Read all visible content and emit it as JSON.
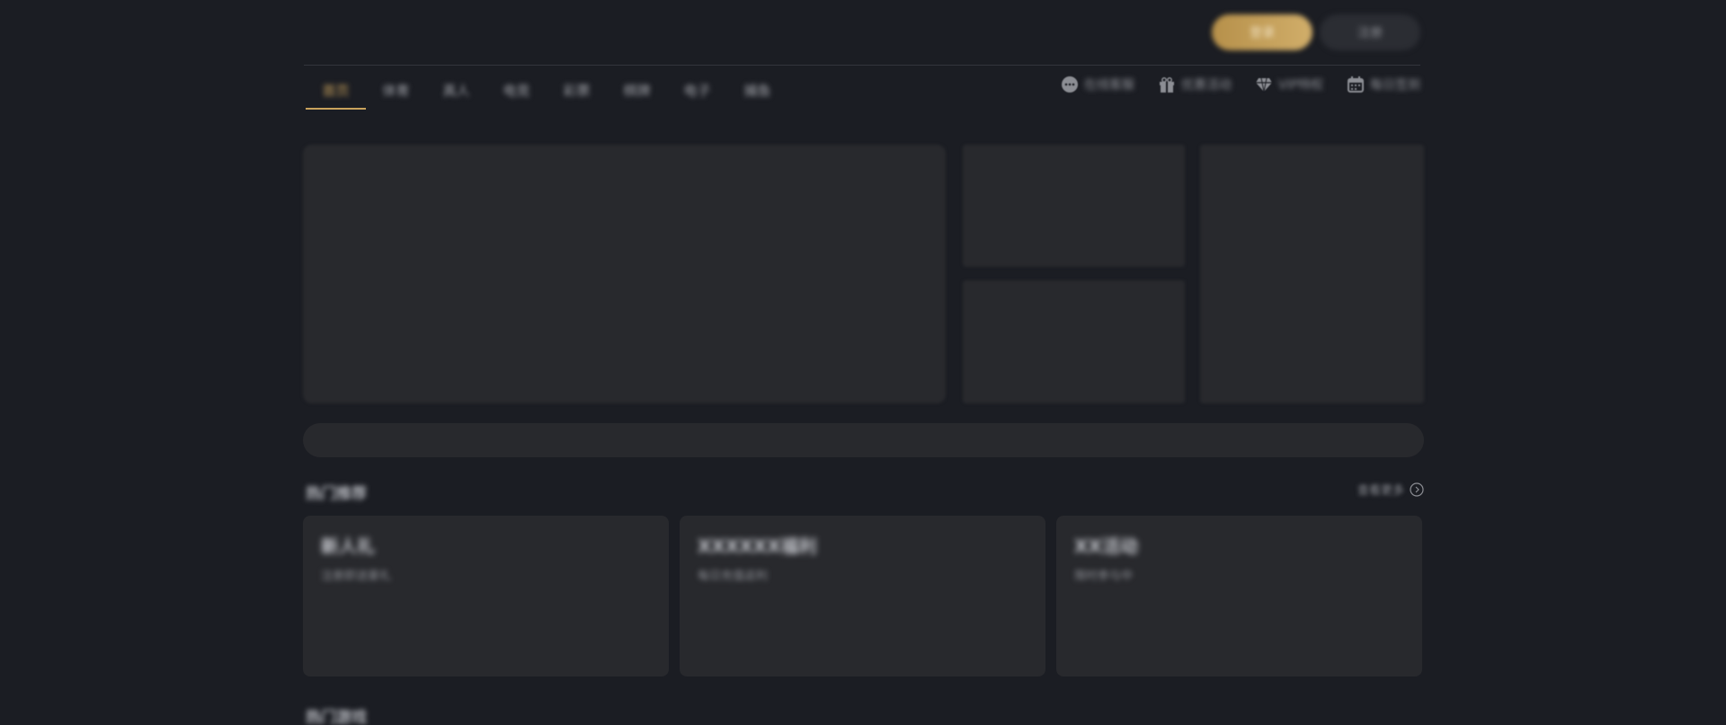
{
  "header": {
    "primary_button": "登录",
    "secondary_button": "注册"
  },
  "nav": {
    "tabs": [
      {
        "label": "首页"
      },
      {
        "label": "体育"
      },
      {
        "label": "真人"
      },
      {
        "label": "电竞"
      },
      {
        "label": "彩票"
      },
      {
        "label": "棋牌"
      },
      {
        "label": "电子"
      },
      {
        "label": "捕鱼"
      }
    ],
    "quick_links": [
      {
        "icon": "chat-icon",
        "label": "在线客服"
      },
      {
        "icon": "gift-icon",
        "label": "优惠活动"
      },
      {
        "icon": "diamond-icon",
        "label": "VIP特权"
      },
      {
        "icon": "calendar-icon",
        "label": "每日签到"
      }
    ]
  },
  "search": {
    "placeholder": ""
  },
  "section_one": {
    "title": "热门推荐",
    "more_label": "查看更多",
    "cards": [
      {
        "title": "新人礼",
        "subtitle": "注册即送豪礼"
      },
      {
        "title": "XXXXXX福利",
        "subtitle": "每日充值返利"
      },
      {
        "title": "XX活动",
        "subtitle": "限时参与中"
      }
    ]
  },
  "section_two": {
    "title": "热门游戏"
  },
  "colors": {
    "background": "#1b1d23",
    "accent": "#c9a25c",
    "panel": "#28292d"
  }
}
